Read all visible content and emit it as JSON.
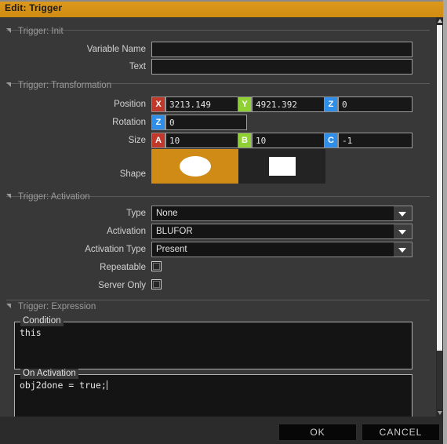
{
  "window": {
    "title": "Edit: Trigger"
  },
  "sections": {
    "init": {
      "title": "Trigger: Init",
      "fields": {
        "variable_name_label": "Variable Name",
        "variable_name_value": "",
        "text_label": "Text",
        "text_value": ""
      }
    },
    "transformation": {
      "title": "Trigger: Transformation",
      "position": {
        "label": "Position",
        "x_axis": "X",
        "x_value": "3213.149",
        "y_axis": "Y",
        "y_value": "4921.392",
        "z_axis": "Z",
        "z_value": "0"
      },
      "rotation": {
        "label": "Rotation",
        "z_axis": "Z",
        "z_value": "0"
      },
      "size": {
        "label": "Size",
        "a_axis": "A",
        "a_value": "10",
        "b_axis": "B",
        "b_value": "10",
        "c_axis": "C",
        "c_value": "-1"
      },
      "shape": {
        "label": "Shape",
        "selected": "ellipse",
        "options": [
          "ellipse",
          "rectangle"
        ]
      }
    },
    "activation": {
      "title": "Trigger: Activation",
      "type": {
        "label": "Type",
        "value": "None"
      },
      "activation": {
        "label": "Activation",
        "value": "BLUFOR"
      },
      "activation_type": {
        "label": "Activation Type",
        "value": "Present"
      },
      "repeatable": {
        "label": "Repeatable",
        "checked": false
      },
      "server_only": {
        "label": "Server Only",
        "checked": false
      }
    },
    "expression": {
      "title": "Trigger: Expression",
      "condition": {
        "legend": "Condition",
        "value": "this"
      },
      "on_activation": {
        "legend": "On Activation",
        "value": "obj2done = true;"
      }
    }
  },
  "footer": {
    "ok_label": "OK",
    "cancel_label": "CANCEL"
  },
  "colors": {
    "titlebar": "#d8941a",
    "axis_x": "#c0392b",
    "axis_y": "#8fd133",
    "axis_z": "#2f8fe8",
    "shape_selected": "#cf8b15",
    "panel_bg": "#383838"
  }
}
